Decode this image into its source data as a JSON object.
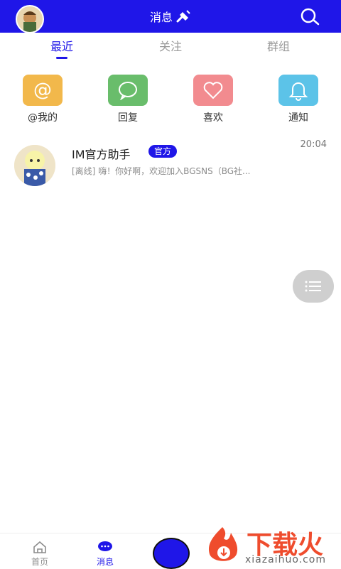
{
  "header": {
    "title": "消息"
  },
  "tabs": [
    {
      "label": "最近",
      "active": true
    },
    {
      "label": "关注",
      "active": false
    },
    {
      "label": "群组",
      "active": false
    }
  ],
  "quick_actions": [
    {
      "label": "@我的",
      "icon": "at-icon",
      "color": "#f2b84b"
    },
    {
      "label": "回复",
      "icon": "chat-bubble-icon",
      "color": "#69bd6b"
    },
    {
      "label": "喜欢",
      "icon": "heart-icon",
      "color": "#f28b8f"
    },
    {
      "label": "通知",
      "icon": "bell-icon",
      "color": "#5cc3e8"
    }
  ],
  "messages": [
    {
      "name": "IM官方助手",
      "badge": "官方",
      "time": "20:04",
      "preview": "[离线] 嗨！你好啊，欢迎加入BGSNS（BG社..."
    }
  ],
  "bottom_nav": [
    {
      "label": "首页",
      "icon": "home-icon",
      "active": false
    },
    {
      "label": "消息",
      "icon": "message-icon",
      "active": true
    }
  ],
  "watermark": {
    "text": "下载火",
    "domain": "xiazaihuo.com"
  },
  "colors": {
    "primary": "#1f16e8"
  }
}
